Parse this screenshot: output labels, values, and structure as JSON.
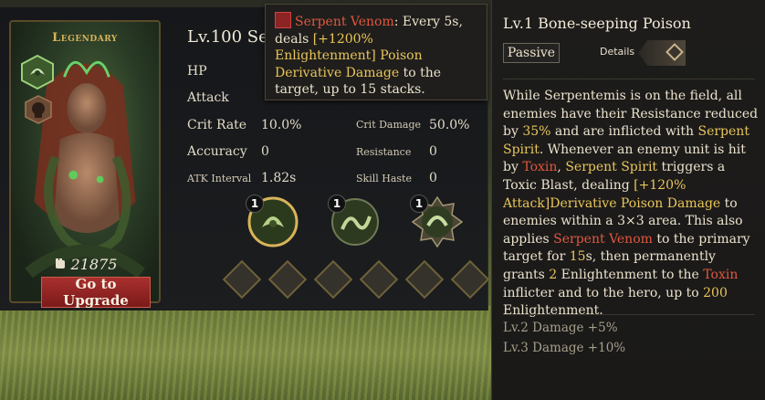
{
  "hero": {
    "rarity": "Legendary",
    "level_name": "Lv.100 Se",
    "power": "21875",
    "upgrade_button": "Go to Upgrade",
    "stats": {
      "hp_label": "HP",
      "attack_label": "Attack",
      "crit_rate_label": "Crit Rate",
      "crit_rate_value": "10.0%",
      "crit_damage_label": "Crit Damage",
      "crit_damage_value": "50.0%",
      "accuracy_label": "Accuracy",
      "accuracy_value": "0",
      "resistance_label": "Resistance",
      "resistance_value": "0",
      "atk_interval_label": "ATK Interval",
      "atk_interval_value": "1.82s",
      "skill_haste_label": "Skill Haste",
      "skill_haste_value": "0"
    },
    "skills": [
      {
        "level": "1",
        "icon": "serpent-skill-icon"
      },
      {
        "level": "1",
        "icon": "serpent-coil-skill-icon"
      },
      {
        "level": "1",
        "icon": "serpent-spirit-skill-icon"
      }
    ]
  },
  "tooltip": {
    "name": "Serpent Venom",
    "text_1": ": Every 5s, deals ",
    "highlight": "[+1200% Enlightenment] Poison Derivative Damage",
    "text_2": " to the target, up to 15 stacks."
  },
  "detail": {
    "title": "Lv.1 Bone-seeping Poison",
    "tag": "Passive",
    "details_label": "Details",
    "desc": {
      "p1": "While Serpentemis is on the field, all enemies have their Resistance reduced by ",
      "v1": "35%",
      "p2": " and are inflicted with ",
      "k1": "Serpent Spirit",
      "p3": ". Whenever an enemy unit is hit by ",
      "k2": "Toxin",
      "p4": ", ",
      "k3": "Serpent Spirit",
      "p5": " triggers a Toxic Blast, dealing ",
      "k4": "[+120% Attack]",
      "k5": "Derivative Poison Damage",
      "p6": " to enemies within a 3×3 area. This also applies ",
      "k6": "Serpent Venom",
      "p7": " to the primary target for ",
      "v2": "15",
      "p8": "s, then permanently grants ",
      "v3": "2",
      "p9": " Enlightenment to the ",
      "k7": "Toxin",
      "p10": " inflicter and to the hero, up to ",
      "v4": "200",
      "p11": " Enlightenment."
    },
    "lv2": "Lv.2 Damage +5%",
    "lv3": "Lv.3 Damage +10%"
  },
  "colors": {
    "highlight_red": "#e0573f",
    "highlight_gold": "#e9c65a",
    "rarity_gold": "#d8b35a",
    "upgrade_red": "#a8302e"
  }
}
